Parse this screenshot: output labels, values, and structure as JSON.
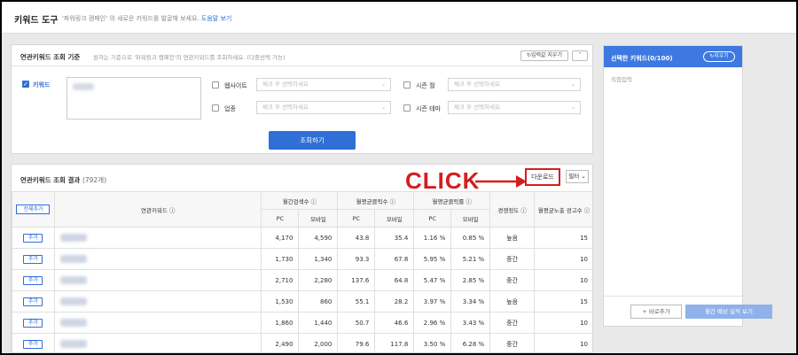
{
  "header": {
    "title": "키워드 도구",
    "desc": "'파워링크 캠페인' 의 새로운 키워드를 발굴해 보세요.",
    "help": "도움말 보기"
  },
  "criteria": {
    "title": "연관키워드 조회 기준",
    "desc": "원하는 기준으로 '파워링크 캠페인'의 연관키워드를 조회하세요. (다중선택 가능)",
    "reset": "입력값 지우기",
    "keyword_label": "키워드",
    "website_label": "웹사이트",
    "industry_label": "업종",
    "season_month_label": "시즌 월",
    "season_theme_label": "시즌 테마",
    "select_placeholder": "체크 후 선택하세요",
    "search_button": "조회하기"
  },
  "results": {
    "title": "연관키워드 조회 결과",
    "count": "(792개)",
    "click_annotation": "CLICK",
    "download": "다운로드",
    "filter": "필터",
    "add_all": "전체추가",
    "columns": {
      "keyword": "연관키워드",
      "monthly_search": "월간검색수",
      "monthly_clicks": "월평균클릭수",
      "monthly_ctr": "월평균클릭률",
      "competition": "경쟁정도",
      "ad_count": "월평균노출 광고수",
      "pc": "PC",
      "mobile": "모바일"
    },
    "add_label": "추가",
    "rows": [
      {
        "s_pc": "4,170",
        "s_mo": "4,590",
        "c_pc": "43.8",
        "c_mo": "35.4",
        "r_pc": "1.16 %",
        "r_mo": "0.85 %",
        "comp": "높음",
        "ads": "15"
      },
      {
        "s_pc": "1,730",
        "s_mo": "1,340",
        "c_pc": "93.3",
        "c_mo": "67.8",
        "r_pc": "5.95 %",
        "r_mo": "5.21 %",
        "comp": "중간",
        "ads": "10"
      },
      {
        "s_pc": "2,710",
        "s_mo": "2,280",
        "c_pc": "137.6",
        "c_mo": "64.8",
        "r_pc": "5.47 %",
        "r_mo": "2.85 %",
        "comp": "중간",
        "ads": "10"
      },
      {
        "s_pc": "1,530",
        "s_mo": "860",
        "c_pc": "55.1",
        "c_mo": "28.2",
        "r_pc": "3.97 %",
        "r_mo": "3.34 %",
        "comp": "높음",
        "ads": "15"
      },
      {
        "s_pc": "1,860",
        "s_mo": "1,440",
        "c_pc": "50.7",
        "c_mo": "46.6",
        "r_pc": "2.96 %",
        "r_mo": "3.43 %",
        "comp": "중간",
        "ads": "10"
      },
      {
        "s_pc": "2,490",
        "s_mo": "2,000",
        "c_pc": "79.6",
        "c_mo": "117.8",
        "r_pc": "3.50 %",
        "r_mo": "6.28 %",
        "comp": "중간",
        "ads": "10"
      }
    ]
  },
  "side": {
    "title": "선택한 키워드(0/100)",
    "clear": "지우기",
    "placeholder": "직접입력",
    "add_bid": "+ 바로추가",
    "estimate": "월간 예상 실적 보기"
  }
}
